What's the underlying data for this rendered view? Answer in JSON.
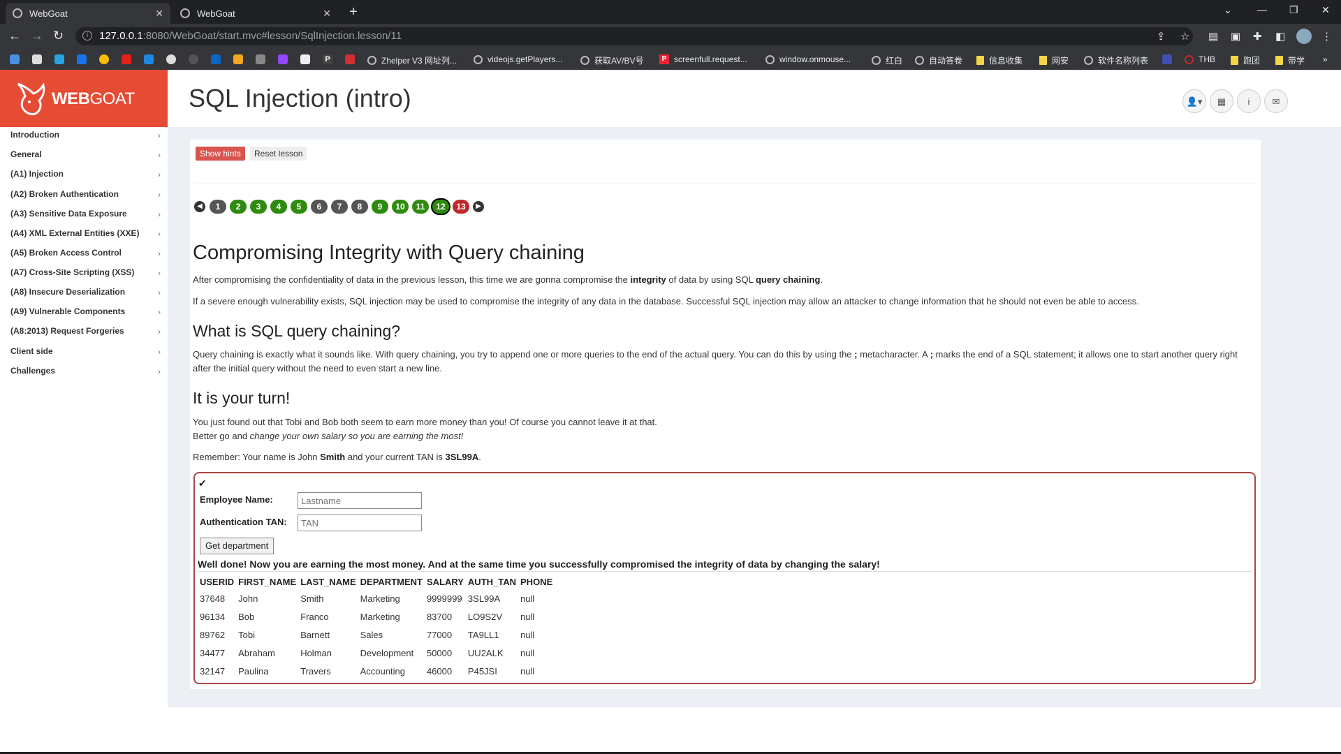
{
  "browser": {
    "tabs": [
      {
        "title": "WebGoat",
        "close": "✕"
      },
      {
        "title": "WebGoat",
        "close": "✕"
      }
    ],
    "new_tab": "+",
    "url_host": "127.0.0.1",
    "url_rest": ":8080/WebGoat/start.mvc#lesson/SqlInjection.lesson/11",
    "bookmarks": [
      "Zhelper V3 网址列...",
      "videojs.getPlayers...",
      "获取AV/BV号",
      "screenfull.request...",
      "window.onmouse...",
      "红白",
      "自动答卷",
      "信息收集",
      "网安",
      "软件名称列表",
      "THB",
      "跑团",
      "带学"
    ]
  },
  "brand": {
    "web": "WEB",
    "goat": "GOAT"
  },
  "header": {
    "title": "SQL Injection (intro)"
  },
  "sidebar": {
    "items": [
      "Introduction",
      "General",
      "(A1) Injection",
      "(A2) Broken Authentication",
      "(A3) Sensitive Data Exposure",
      "(A4) XML External Entities (XXE)",
      "(A5) Broken Access Control",
      "(A7) Cross-Site Scripting (XSS)",
      "(A8) Insecure Deserialization",
      "(A9) Vulnerable Components",
      "(A8:2013) Request Forgeries",
      "Client side",
      "Challenges"
    ]
  },
  "lesson": {
    "show_hints": "Show hints",
    "reset_lesson": "Reset lesson",
    "pages": [
      "1",
      "2",
      "3",
      "4",
      "5",
      "6",
      "7",
      "8",
      "9",
      "10",
      "11",
      "12",
      "13"
    ],
    "heading": "Compromising Integrity with Query chaining",
    "p1_a": "After compromising the confidentiality of data in the previous lesson, this time we are gonna compromise the ",
    "p1_b": "integrity",
    "p1_c": " of data by using SQL ",
    "p1_d": "query chaining",
    "p1_e": ".",
    "p2": "If a severe enough vulnerability exists, SQL injection may be used to compromise the integrity of any data in the database. Successful SQL injection may allow an attacker to change information that he should not even be able to access.",
    "h_chain": "What is SQL query chaining?",
    "p3_a": "Query chaining is exactly what it sounds like. With query chaining, you try to append one or more queries to the end of the actual query. You can do this by using the ",
    "p3_b": ";",
    "p3_c": " metacharacter. A ",
    "p3_d": ";",
    "p3_e": " marks the end of a SQL statement; it allows one to start another query right after the initial query without the need to even start a new line.",
    "h_turn": "It is your turn!",
    "p4": "You just found out that Tobi and Bob both seem to earn more money than you! Of course you cannot leave it at that.",
    "p5_a": "Better go and ",
    "p5_b": "change your own salary so you are earning the most!",
    "p6_a": "Remember: Your name is John ",
    "p6_b": "Smith",
    "p6_c": " and your current TAN is ",
    "p6_d": "3SL99A",
    "p6_e": ".",
    "form": {
      "check": "✔",
      "name_label": "Employee Name:",
      "name_placeholder": "Lastname",
      "tan_label": "Authentication TAN:",
      "tan_placeholder": "TAN",
      "submit": "Get department"
    },
    "feedback": "Well done! Now you are earning the most money. And at the same time you successfully compromised the integrity of data by changing the salary!",
    "table": {
      "headers": [
        "USERID",
        "FIRST_NAME",
        "LAST_NAME",
        "DEPARTMENT",
        "SALARY",
        "AUTH_TAN",
        "PHONE"
      ],
      "rows": [
        [
          "37648",
          "John",
          "Smith",
          "Marketing",
          "9999999",
          "3SL99A",
          "null"
        ],
        [
          "96134",
          "Bob",
          "Franco",
          "Marketing",
          "83700",
          "LO9S2V",
          "null"
        ],
        [
          "89762",
          "Tobi",
          "Barnett",
          "Sales",
          "77000",
          "TA9LL1",
          "null"
        ],
        [
          "34477",
          "Abraham",
          "Holman",
          "Development",
          "50000",
          "UU2ALK",
          "null"
        ],
        [
          "32147",
          "Paulina",
          "Travers",
          "Accounting",
          "46000",
          "P45JSI",
          "null"
        ]
      ]
    }
  }
}
